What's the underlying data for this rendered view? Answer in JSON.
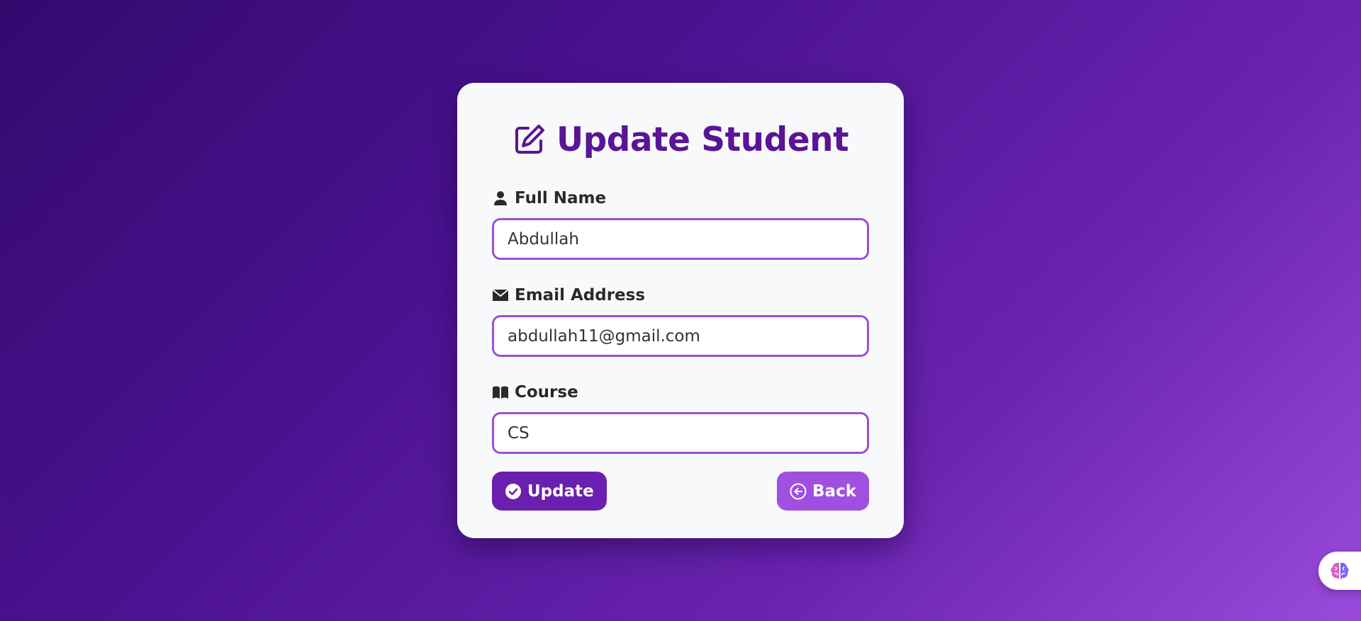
{
  "form": {
    "title": "Update Student",
    "title_icon": "edit-icon",
    "fields": [
      {
        "label": "Full Name",
        "icon": "user-icon",
        "value": "Abdullah"
      },
      {
        "label": "Email Address",
        "icon": "envelope-icon",
        "value": "abdullah11@gmail.com"
      },
      {
        "label": "Course",
        "icon": "book-icon",
        "value": "CS"
      }
    ],
    "update_button": {
      "label": "Update",
      "icon": "check-circle-icon"
    },
    "back_button": {
      "label": "Back",
      "icon": "arrow-left-circle-icon"
    }
  },
  "floating_widget": {
    "icon": "brain-icon"
  },
  "colors": {
    "accent": "#5a1596",
    "update_button": "#6a1fb0",
    "back_button": "#a04fe0",
    "input_border": "#9b4fd6",
    "card_background": "#f8f9fa"
  }
}
